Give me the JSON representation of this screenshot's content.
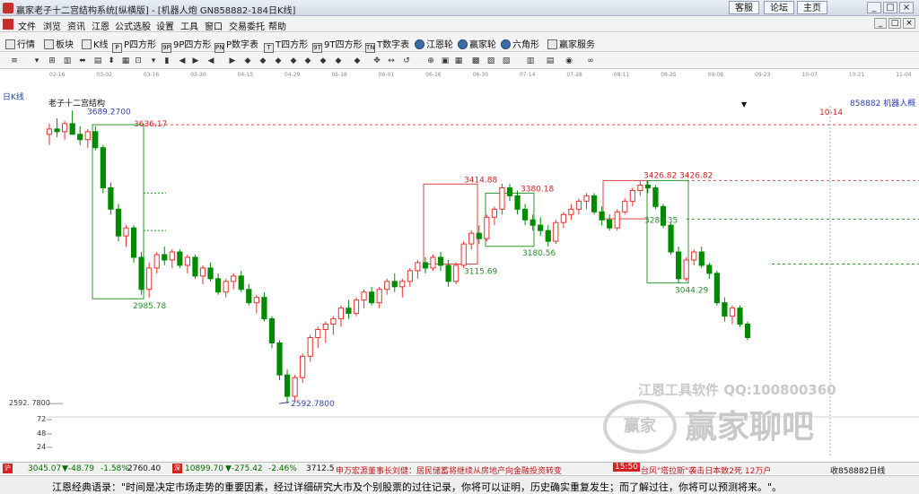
{
  "window": {
    "title": "赢家老子十二宫结构系统[纵横版] - [机器人炮 GN858882-184日K线]",
    "links": [
      "客服",
      "论坛",
      "主页"
    ],
    "buttons": [
      "_",
      "□",
      "×"
    ]
  },
  "menu": [
    "文件",
    "浏览",
    "资讯",
    "江恩",
    "公式选股",
    "设置",
    "工具",
    "窗口",
    "交易委托",
    "帮助"
  ],
  "toolbar1": [
    {
      "label": "行情",
      "icon": "grid-icon"
    },
    {
      "label": "板块",
      "icon": "block-icon"
    },
    {
      "label": "K线",
      "icon": "kline-icon"
    },
    {
      "label": "P四方形",
      "icon": "p-square-icon",
      "tag": "P"
    },
    {
      "label": "9P四方形",
      "icon": "9p-square-icon",
      "tag": "9P"
    },
    {
      "label": "P数字表",
      "icon": "p-table-icon",
      "tag": "PN"
    },
    {
      "label": "T四方形",
      "icon": "t-square-icon",
      "tag": "T"
    },
    {
      "label": "9T四方形",
      "icon": "9t-square-icon",
      "tag": "9T"
    },
    {
      "label": "T数字表",
      "icon": "t-table-icon",
      "tag": "TN"
    },
    {
      "label": "江恩轮",
      "icon": "gann-wheel-icon",
      "round": true
    },
    {
      "label": "赢家轮",
      "icon": "winner-wheel-icon",
      "round": true
    },
    {
      "label": "六角形",
      "icon": "hexagon-icon",
      "round": true
    },
    {
      "label": "赢家服务",
      "icon": "service-icon"
    }
  ],
  "toolbar2_icons": [
    "≡",
    "▾",
    "⊞",
    "▥",
    "⬌",
    "▤",
    "⬍",
    "▦",
    "⊡",
    "▾",
    "▮",
    "◀",
    "▶",
    "◀",
    "▶",
    "◆",
    "◆",
    "◆",
    "◆",
    "◆",
    "◆",
    "◆",
    "◆",
    "✥",
    "↔",
    "↺",
    "⊕",
    "▣",
    "▦",
    "▩",
    "▨",
    "▧",
    "▥",
    "▤",
    "◉",
    "∞"
  ],
  "date_ticks": [
    "02-16",
    "03-02",
    "03-16",
    "03-30",
    "04-15",
    "04-29",
    "05-18",
    "06-01",
    "06-16",
    "06-30",
    "07-14",
    "07-28",
    "08-11",
    "08-25",
    "09-08",
    "09-23",
    "10-07",
    "10-21",
    "11-04"
  ],
  "chart": {
    "period_label": "日K线",
    "structure_label": "老子十二宫结构",
    "code_label": "858882 机器人概",
    "future_label": "10-14",
    "left_scale_top": "2592. 7800",
    "volume_ticks": [
      "72",
      "48",
      "24"
    ]
  },
  "chart_data": {
    "type": "candlestick",
    "annotations": [
      {
        "text": "3689.2700",
        "kind": "high"
      },
      {
        "text": "3636.17",
        "kind": "resistance"
      },
      {
        "text": "2985.78",
        "kind": "box-low"
      },
      {
        "text": "2592.7800",
        "kind": "low"
      },
      {
        "text": "3414.88",
        "kind": "box-high"
      },
      {
        "text": "3115.69",
        "kind": "box-low"
      },
      {
        "text": "3380.18",
        "kind": "box-high"
      },
      {
        "text": "3180.56",
        "kind": "box-low"
      },
      {
        "text": "3426.82 3426.82",
        "kind": "box-high"
      },
      {
        "text": "3283.35",
        "kind": "level"
      },
      {
        "text": "3044.29",
        "kind": "box-low"
      }
    ],
    "candles": [
      [
        3600,
        3640,
        3560,
        3620
      ],
      [
        3620,
        3660,
        3590,
        3610
      ],
      [
        3610,
        3650,
        3580,
        3640
      ],
      [
        3640,
        3689,
        3610,
        3600
      ],
      [
        3600,
        3630,
        3560,
        3580
      ],
      [
        3580,
        3620,
        3550,
        3610
      ],
      [
        3610,
        3630,
        3540,
        3550
      ],
      [
        3550,
        3560,
        3380,
        3400
      ],
      [
        3400,
        3420,
        3300,
        3320
      ],
      [
        3320,
        3340,
        3200,
        3220
      ],
      [
        3220,
        3260,
        3180,
        3250
      ],
      [
        3250,
        3260,
        3120,
        3140
      ],
      [
        3140,
        3160,
        3000,
        3020
      ],
      [
        3020,
        3120,
        2990,
        3100
      ],
      [
        3100,
        3160,
        3080,
        3150
      ],
      [
        3150,
        3180,
        3110,
        3130
      ],
      [
        3130,
        3170,
        3100,
        3160
      ],
      [
        3160,
        3170,
        3100,
        3110
      ],
      [
        3110,
        3150,
        3080,
        3140
      ],
      [
        3140,
        3150,
        3060,
        3070
      ],
      [
        3070,
        3110,
        3040,
        3100
      ],
      [
        3100,
        3120,
        3050,
        3060
      ],
      [
        3060,
        3080,
        3000,
        3010
      ],
      [
        3010,
        3060,
        2990,
        3050
      ],
      [
        3050,
        3080,
        3020,
        3070
      ],
      [
        3070,
        3090,
        3010,
        3020
      ],
      [
        3020,
        3040,
        2960,
        2970
      ],
      [
        2970,
        3000,
        2930,
        2990
      ],
      [
        2990,
        3010,
        2900,
        2910
      ],
      [
        2910,
        2920,
        2800,
        2820
      ],
      [
        2820,
        2830,
        2680,
        2700
      ],
      [
        2700,
        2720,
        2593,
        2620
      ],
      [
        2620,
        2700,
        2600,
        2690
      ],
      [
        2690,
        2780,
        2670,
        2770
      ],
      [
        2770,
        2850,
        2750,
        2840
      ],
      [
        2840,
        2880,
        2800,
        2870
      ],
      [
        2870,
        2900,
        2820,
        2890
      ],
      [
        2890,
        2920,
        2850,
        2910
      ],
      [
        2910,
        2960,
        2880,
        2950
      ],
      [
        2950,
        2980,
        2910,
        2930
      ],
      [
        2930,
        2990,
        2920,
        2980
      ],
      [
        2980,
        3020,
        2950,
        3010
      ],
      [
        3010,
        3030,
        2960,
        2970
      ],
      [
        2970,
        3030,
        2950,
        3020
      ],
      [
        3020,
        3060,
        3000,
        3050
      ],
      [
        3050,
        3080,
        3010,
        3030
      ],
      [
        3030,
        3060,
        2990,
        3050
      ],
      [
        3050,
        3100,
        3030,
        3090
      ],
      [
        3090,
        3130,
        3060,
        3120
      ],
      [
        3120,
        3140,
        3080,
        3100
      ],
      [
        3100,
        3150,
        3090,
        3140
      ],
      [
        3140,
        3160,
        3090,
        3110
      ],
      [
        3110,
        3130,
        3030,
        3050
      ],
      [
        3050,
        3120,
        3040,
        3110
      ],
      [
        3110,
        3200,
        3100,
        3190
      ],
      [
        3190,
        3240,
        3170,
        3230
      ],
      [
        3230,
        3260,
        3190,
        3210
      ],
      [
        3210,
        3300,
        3200,
        3290
      ],
      [
        3290,
        3330,
        3260,
        3320
      ],
      [
        3320,
        3415,
        3300,
        3400
      ],
      [
        3400,
        3415,
        3350,
        3370
      ],
      [
        3370,
        3390,
        3300,
        3320
      ],
      [
        3320,
        3340,
        3260,
        3280
      ],
      [
        3280,
        3300,
        3240,
        3260
      ],
      [
        3260,
        3290,
        3220,
        3240
      ],
      [
        3240,
        3260,
        3181,
        3200
      ],
      [
        3200,
        3280,
        3190,
        3270
      ],
      [
        3270,
        3310,
        3250,
        3300
      ],
      [
        3300,
        3340,
        3280,
        3320
      ],
      [
        3320,
        3360,
        3300,
        3350
      ],
      [
        3350,
        3380,
        3320,
        3370
      ],
      [
        3370,
        3380,
        3300,
        3310
      ],
      [
        3310,
        3330,
        3260,
        3280
      ],
      [
        3280,
        3300,
        3240,
        3250
      ],
      [
        3250,
        3320,
        3240,
        3310
      ],
      [
        3310,
        3360,
        3300,
        3350
      ],
      [
        3350,
        3400,
        3330,
        3390
      ],
      [
        3390,
        3427,
        3370,
        3410
      ],
      [
        3410,
        3427,
        3380,
        3400
      ],
      [
        3400,
        3410,
        3320,
        3330
      ],
      [
        3330,
        3340,
        3250,
        3260
      ],
      [
        3260,
        3270,
        3150,
        3160
      ],
      [
        3160,
        3180,
        3044,
        3060
      ],
      [
        3060,
        3140,
        3050,
        3130
      ],
      [
        3130,
        3170,
        3110,
        3160
      ],
      [
        3160,
        3180,
        3100,
        3110
      ],
      [
        3110,
        3120,
        3060,
        3080
      ],
      [
        3080,
        3090,
        2960,
        2970
      ],
      [
        2970,
        2990,
        2900,
        2920
      ],
      [
        2920,
        2960,
        2890,
        2950
      ],
      [
        2950,
        2960,
        2880,
        2890
      ],
      [
        2890,
        2900,
        2830,
        2840
      ]
    ],
    "volume_ylim": [
      0,
      80
    ]
  },
  "watermark": {
    "line1": "江恩工具软件  QQ:100800360",
    "line2": "赢家聊吧",
    "seal": "赢家"
  },
  "ticker": {
    "sh_value": "3045.07",
    "sh_change": "▼-48.79",
    "sh_pct": "-1.58%",
    "sh_amount": "2760.40",
    "sz_value": "10899.70",
    "sz_change": "▼-275.42",
    "sz_pct": "-2.46%",
    "sz_amount": "3712.5",
    "news1": "申万宏源董事长刘健：居民储蓄将继续从房地产向金融投资转变",
    "news_time": "15:50",
    "news2": "台风\"塔拉斯\"袭击日本致2死 12万户",
    "right_status": "收858882日线"
  },
  "footer": {
    "quote": "江恩经典语录：\"时间是决定市场走势的重要因素，经过详细研究大市及个别股票的过往记录，你将可以证明，历史确实重复发生；而了解过往，你将可以预测将来。\"。"
  },
  "colors": {
    "up": "#e5322d",
    "down": "#008a00",
    "label_blue": "#3344aa",
    "label_red": "#d22222"
  }
}
